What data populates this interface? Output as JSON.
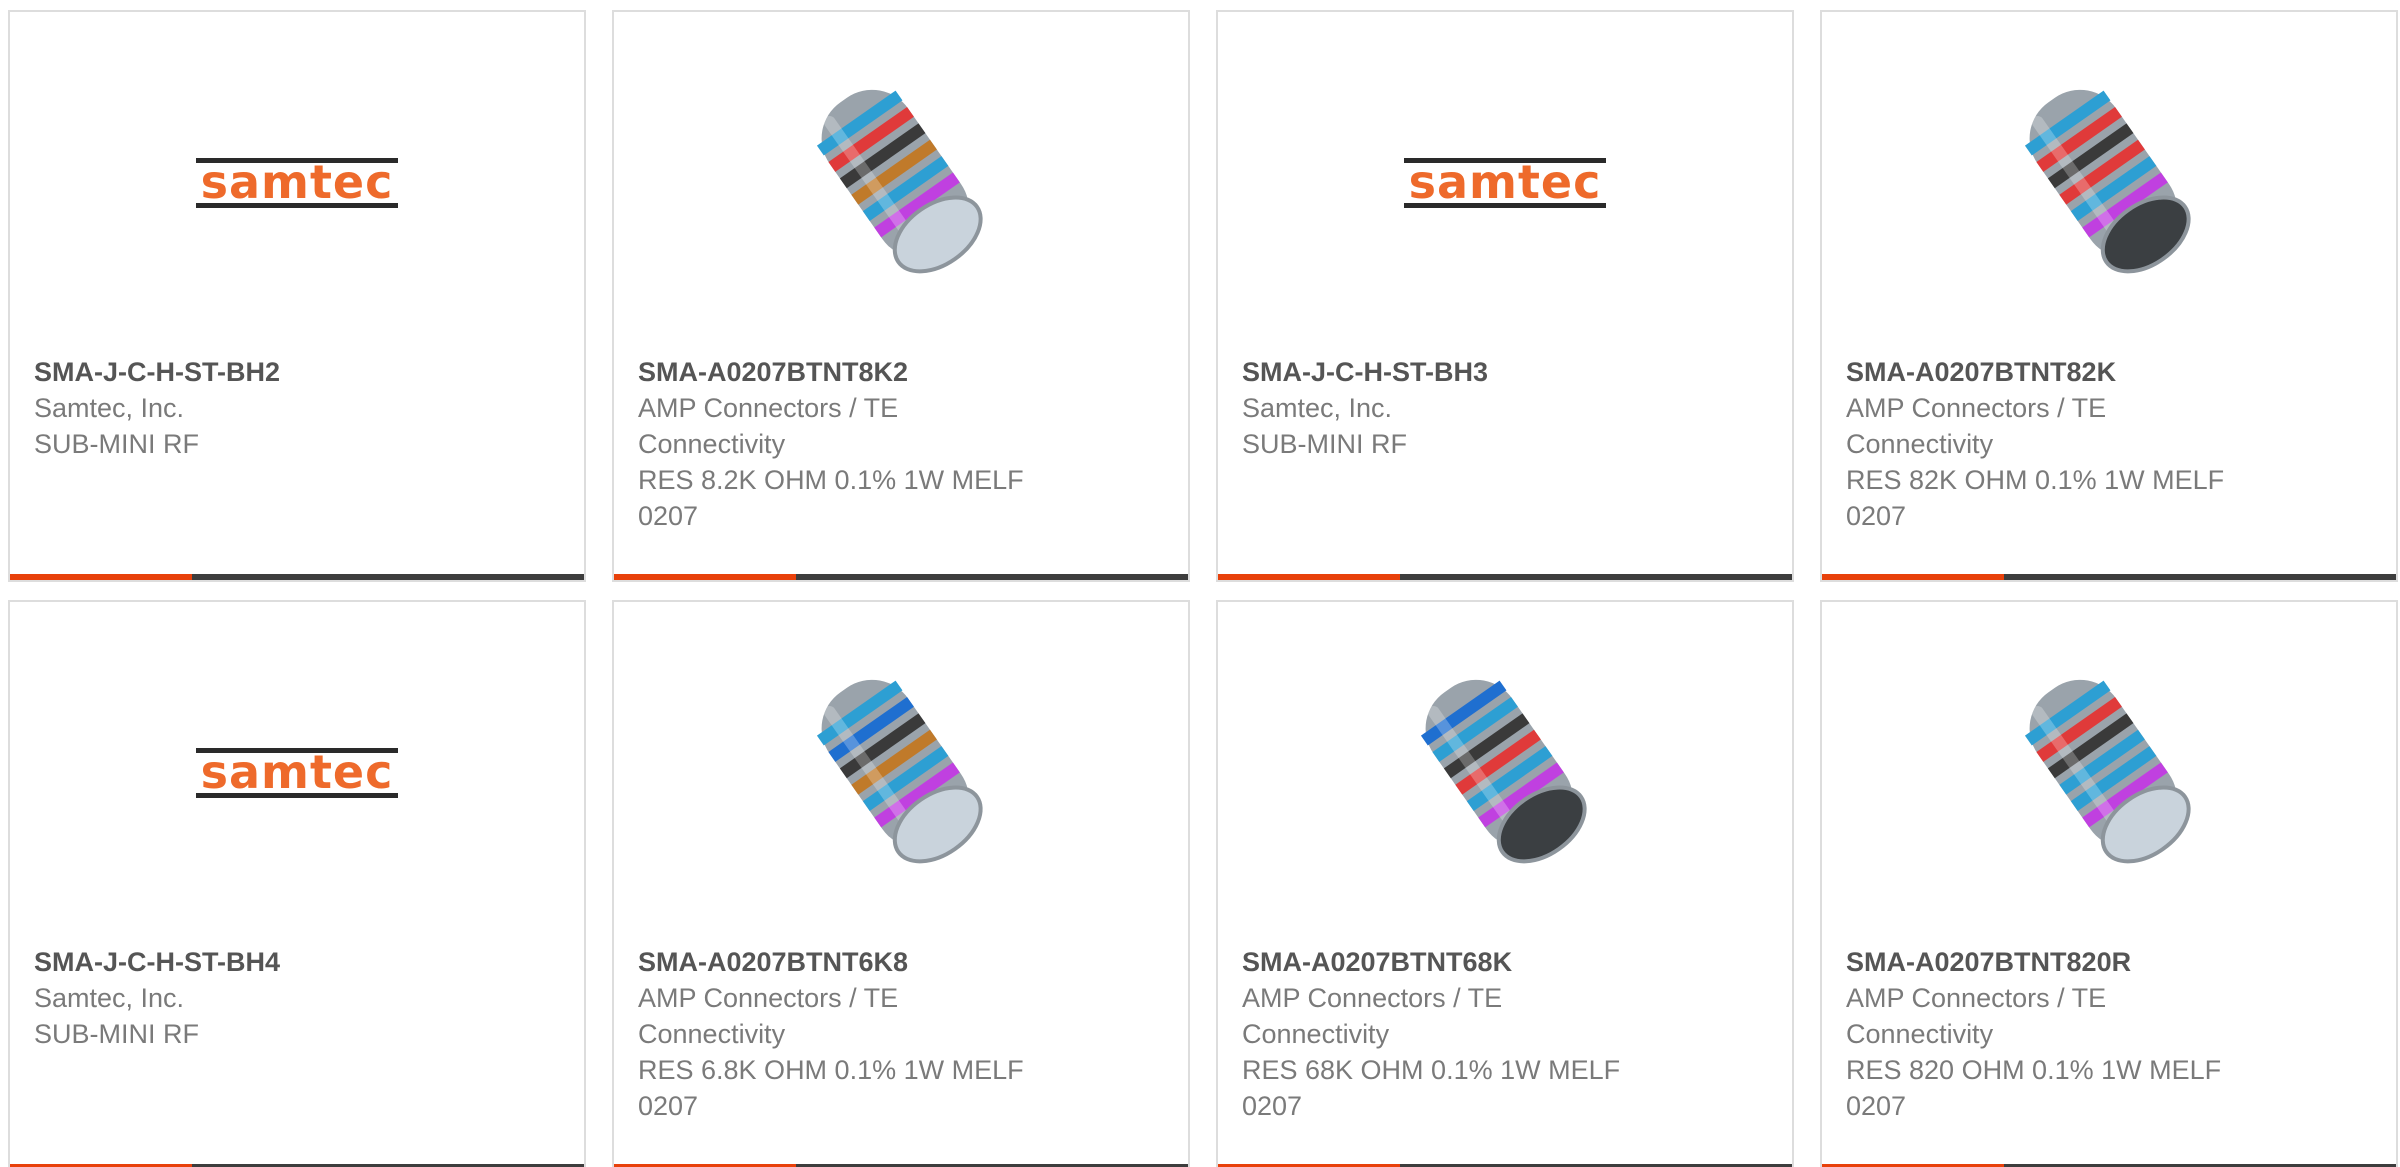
{
  "products": [
    {
      "part_number": "SMA-J-C-H-ST-BH2",
      "manufacturer_lines": [
        "Samtec, Inc."
      ],
      "description_lines": [
        "SUB-MINI RF"
      ],
      "image": "samtec-logo",
      "logo_text": "samtec"
    },
    {
      "part_number": "SMA-A0207BTNT8K2",
      "manufacturer_lines": [
        "AMP Connectors / TE",
        "Connectivity"
      ],
      "description_lines": [
        "RES 8.2K OHM 0.1% 1W MELF",
        "0207"
      ],
      "image": "melf-resistor",
      "bands": [
        "#2d9fd3",
        "#e03a3a",
        "#3a3a3a",
        "#c07a2a",
        "#2d9fd3",
        "#c040e0"
      ],
      "cap": "light"
    },
    {
      "part_number": "SMA-J-C-H-ST-BH3",
      "manufacturer_lines": [
        "Samtec, Inc."
      ],
      "description_lines": [
        "SUB-MINI RF"
      ],
      "image": "samtec-logo",
      "logo_text": "samtec"
    },
    {
      "part_number": "SMA-A0207BTNT82K",
      "manufacturer_lines": [
        "AMP Connectors / TE",
        "Connectivity"
      ],
      "description_lines": [
        "RES 82K OHM 0.1% 1W MELF",
        "0207"
      ],
      "image": "melf-resistor",
      "bands": [
        "#2d9fd3",
        "#e03a3a",
        "#3a3a3a",
        "#e03a3a",
        "#2d9fd3",
        "#c040e0"
      ],
      "cap": "dark"
    },
    {
      "part_number": "SMA-J-C-H-ST-BH4",
      "manufacturer_lines": [
        "Samtec, Inc."
      ],
      "description_lines": [
        "SUB-MINI RF"
      ],
      "image": "samtec-logo",
      "logo_text": "samtec"
    },
    {
      "part_number": "SMA-A0207BTNT6K8",
      "manufacturer_lines": [
        "AMP Connectors / TE",
        "Connectivity"
      ],
      "description_lines": [
        "RES 6.8K OHM 0.1% 1W MELF",
        "0207"
      ],
      "image": "melf-resistor",
      "bands": [
        "#2d9fd3",
        "#1f6fd0",
        "#3a3a3a",
        "#c07a2a",
        "#2d9fd3",
        "#c040e0"
      ],
      "cap": "light"
    },
    {
      "part_number": "SMA-A0207BTNT68K",
      "manufacturer_lines": [
        "AMP Connectors / TE",
        "Connectivity"
      ],
      "description_lines": [
        "RES 68K OHM 0.1% 1W MELF",
        "0207"
      ],
      "image": "melf-resistor",
      "bands": [
        "#1f6fd0",
        "#2d9fd3",
        "#3a3a3a",
        "#e03a3a",
        "#2d9fd3",
        "#c040e0"
      ],
      "cap": "dark"
    },
    {
      "part_number": "SMA-A0207BTNT820R",
      "manufacturer_lines": [
        "AMP Connectors / TE",
        "Connectivity"
      ],
      "description_lines": [
        "RES 820 OHM 0.1% 1W MELF",
        "0207"
      ],
      "image": "melf-resistor",
      "bands": [
        "#2d9fd3",
        "#e03a3a",
        "#3a3a3a",
        "#2d9fd3",
        "#2d9fd3",
        "#c040e0"
      ],
      "cap": "light"
    }
  ],
  "colors": {
    "accent": "#e8410b",
    "bar_dark": "#3d3d3d",
    "logo_orange": "#ee6a2b"
  }
}
